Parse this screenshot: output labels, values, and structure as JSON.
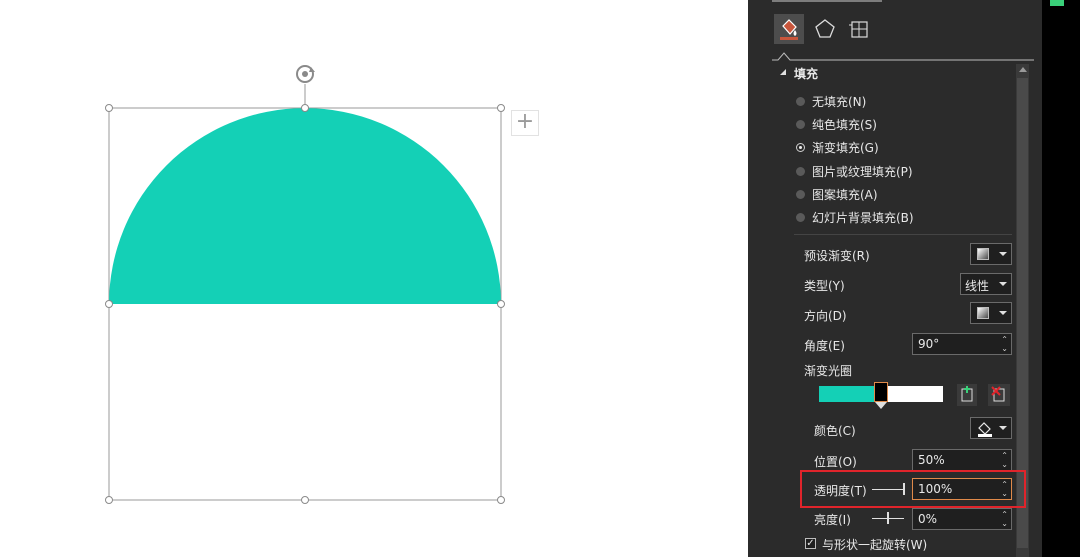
{
  "canvas": {
    "shape_color": "#14d0b6",
    "rotate_icon": "rotate-handle-icon",
    "plus_icon": "plus-icon"
  },
  "panel": {
    "section_title": "填充",
    "fill_options": [
      {
        "label": "无填充(N)",
        "selected": false
      },
      {
        "label": "纯色填充(S)",
        "selected": false
      },
      {
        "label": "渐变填充(G)",
        "selected": true
      },
      {
        "label": "图片或纹理填充(P)",
        "selected": false
      },
      {
        "label": "图案填充(A)",
        "selected": false
      },
      {
        "label": "幻灯片背景填充(B)",
        "selected": false
      }
    ],
    "preset_gradient_label": "预设渐变(R)",
    "type_label": "类型(Y)",
    "type_value": "线性",
    "direction_label": "方向(D)",
    "angle_label": "角度(E)",
    "angle_value": "90°",
    "stops_label": "渐变光圈",
    "color_label": "颜色(C)",
    "position_label": "位置(O)",
    "position_value": "50%",
    "transparency_label": "透明度(T)",
    "transparency_value": "100%",
    "brightness_label": "亮度(I)",
    "brightness_value": "0%",
    "rotate_with_shape_label": "与形状一起旋转(W)",
    "rotate_with_shape_checked": true,
    "highlight_color": "#e0242b",
    "accent_color": "#14d0b6"
  }
}
